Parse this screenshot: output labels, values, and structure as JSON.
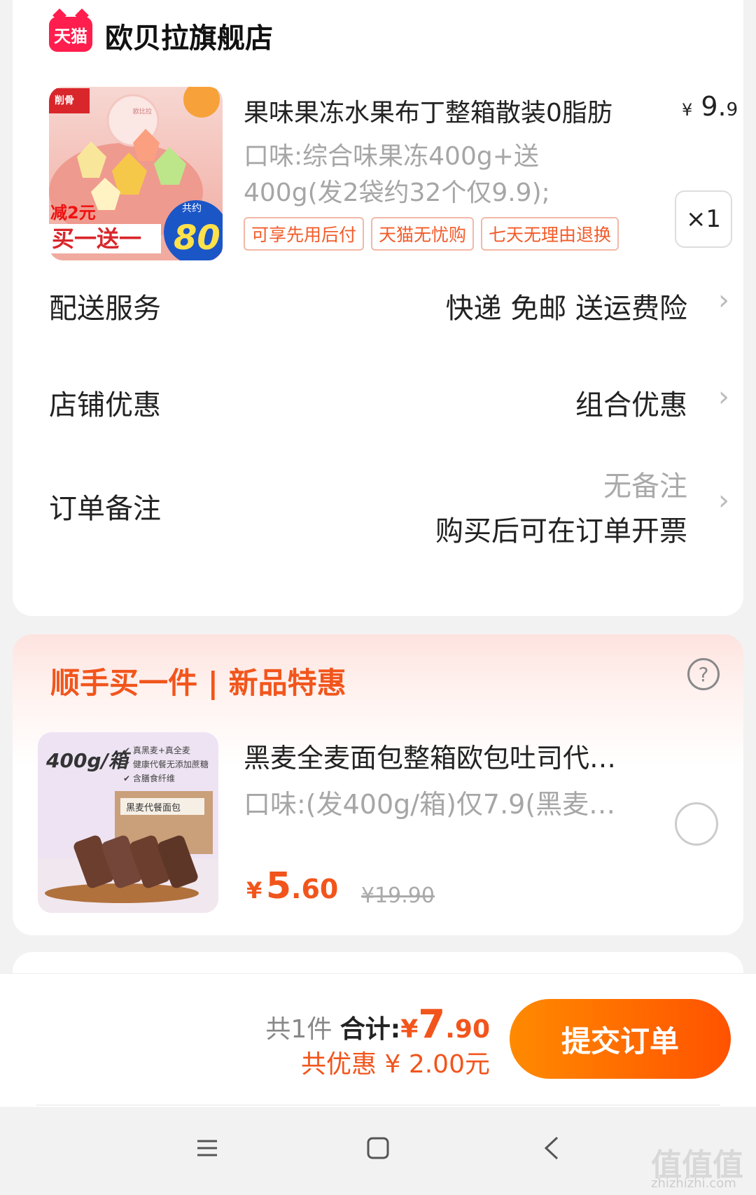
{
  "store": {
    "logo_text": "天猫",
    "name": "欧贝拉旗舰店"
  },
  "product": {
    "image_labels": {
      "brand": "欧比拉",
      "promo_line1": "减2元",
      "promo_line2": "买一送一",
      "count_label": "共约",
      "count_value": "80"
    },
    "title": "果味果冻水果布丁整箱散装0脂肪",
    "price_symbol": "¥",
    "price_int": "9.",
    "price_dec": "9",
    "spec": "口味:综合味果冻400g+送400g(发2袋约32个仅9.9);",
    "tags": [
      "可享先用后付",
      "天猫无忧购",
      "七天无理由退换"
    ],
    "quantity": "×1"
  },
  "rows": {
    "delivery": {
      "label": "配送服务",
      "value": "快递 免邮 送运费险"
    },
    "store_discount": {
      "label": "店铺优惠",
      "value": "组合优惠"
    },
    "order_note": {
      "label": "订单备注",
      "value": "无备注",
      "sub": "购买后可在订单开票"
    }
  },
  "addon": {
    "title": "顺手买一件 | 新品特惠",
    "product": {
      "image_labels": {
        "weight": "400g/箱",
        "check1": "真黑麦+真全麦",
        "check2": "健康代餐无添加蔗糖",
        "check3": "含膳食纤维",
        "box_label": "黑麦代餐面包"
      },
      "title": "黑麦全麦面包整箱欧包吐司代…",
      "spec": "口味:(发400g/箱)仅7.9(黑麦…",
      "price_symbol": "¥",
      "price_int": "5",
      "price_dec": ".60",
      "original_price": "¥19.90",
      "selected": false
    }
  },
  "summary": {
    "count": "共1件",
    "total_label": "合计:",
    "total_symbol": "¥",
    "total_int": "7",
    "total_dec": ".90",
    "discount": "共优惠 ¥ 2.00元",
    "submit_label": "提交订单"
  },
  "watermark": {
    "text": "值值值",
    "sub": "zhizhizhi.com"
  },
  "colors": {
    "accent": "#f2551c",
    "brand_red": "#ff1e4d",
    "button_gradient": [
      "#ff8a00",
      "#ff5200"
    ]
  },
  "icons": [
    "tmall-logo",
    "chevron-right-icon",
    "help-icon",
    "menu-icon",
    "home-icon",
    "back-icon"
  ]
}
